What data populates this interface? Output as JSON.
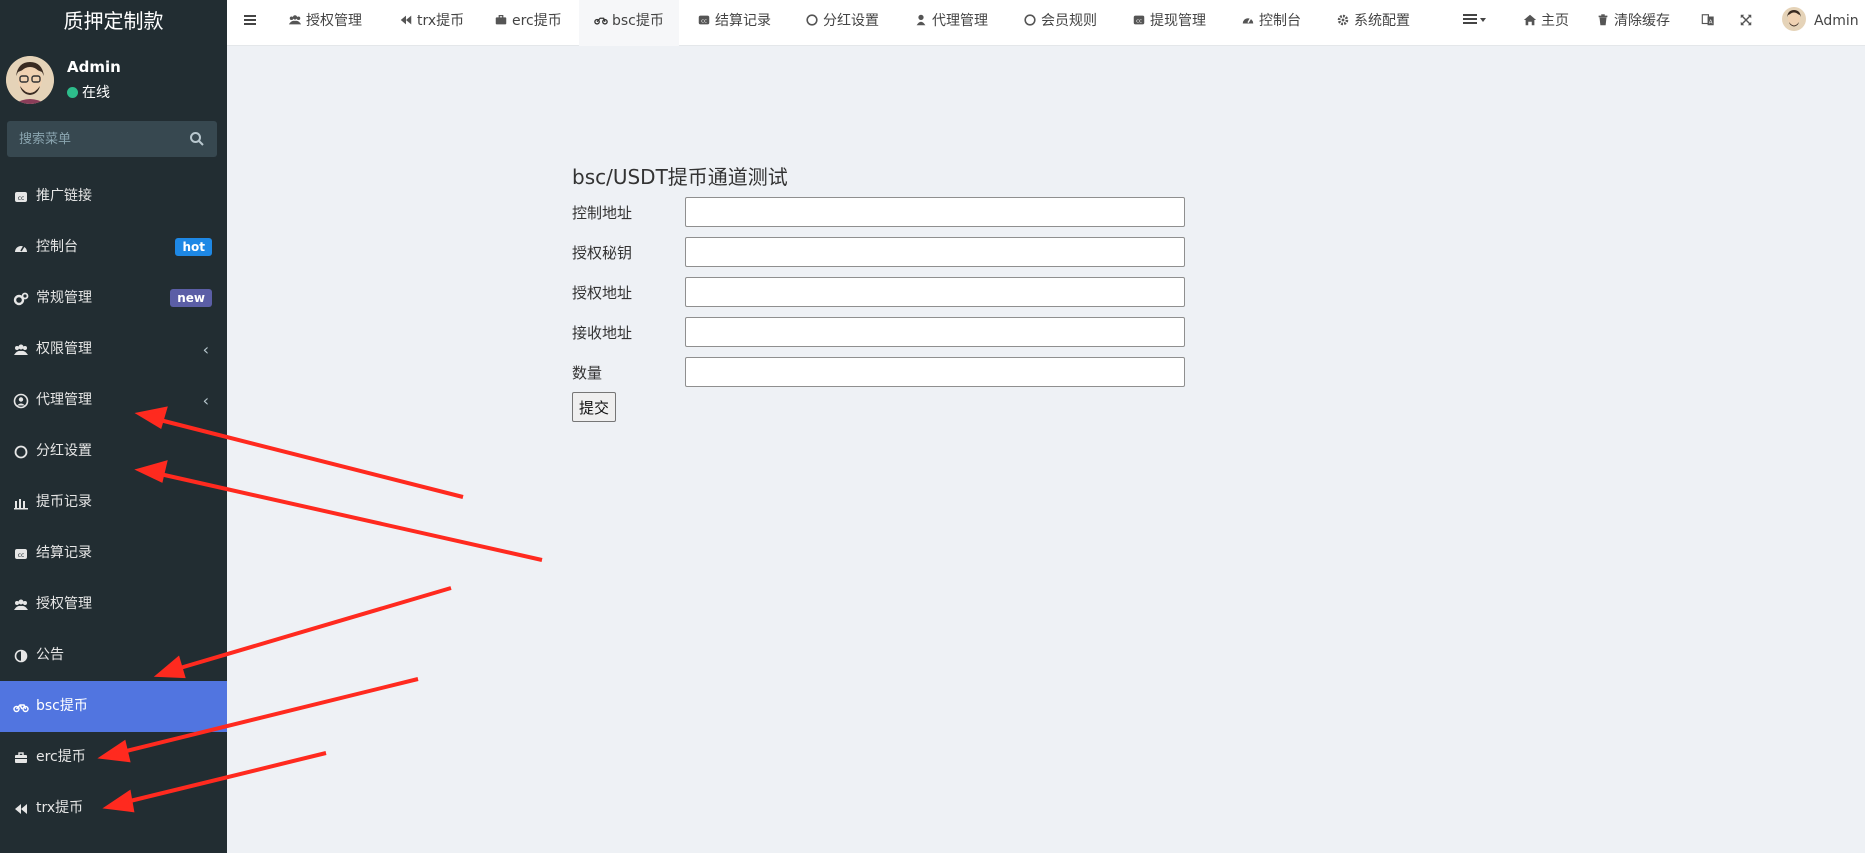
{
  "brand": "质押定制款",
  "user": {
    "name": "Admin",
    "status": "在线"
  },
  "search": {
    "placeholder": "搜索菜单"
  },
  "sidebar": {
    "items": [
      {
        "label": "推广链接"
      },
      {
        "label": "控制台",
        "badge": "hot"
      },
      {
        "label": "常规管理",
        "badge": "new"
      },
      {
        "label": "权限管理",
        "chevron": "‹"
      },
      {
        "label": "代理管理",
        "chevron": "‹"
      },
      {
        "label": "分红设置"
      },
      {
        "label": "提币记录"
      },
      {
        "label": "结算记录"
      },
      {
        "label": "授权管理"
      },
      {
        "label": "公告"
      },
      {
        "label": "bsc提币"
      },
      {
        "label": "erc提币"
      },
      {
        "label": "trx提币"
      }
    ]
  },
  "topbar": {
    "tabs": [
      "授权管理",
      "trx提币",
      "erc提币",
      "bsc提币",
      "结算记录",
      "分红设置",
      "代理管理",
      "会员规则",
      "提现管理",
      "控制台",
      "系统配置"
    ],
    "right": {
      "home": "主页",
      "clear_cache": "清除缓存",
      "user": "Admin"
    }
  },
  "form": {
    "title": "bsc/USDT提币通道测试",
    "fields": [
      {
        "label": "控制地址",
        "value": ""
      },
      {
        "label": "授权秘钥",
        "value": ""
      },
      {
        "label": "授权地址",
        "value": ""
      },
      {
        "label": "接收地址",
        "value": ""
      },
      {
        "label": "数量",
        "value": ""
      }
    ],
    "submit": "提交"
  },
  "colors": {
    "sidebar_bg": "#222d32",
    "active_item": "#5175e0",
    "hot_badge": "#1e88e5",
    "new_badge": "#5b5ea6",
    "arrow": "#ff2a1f",
    "online": "#2dbd8b"
  }
}
